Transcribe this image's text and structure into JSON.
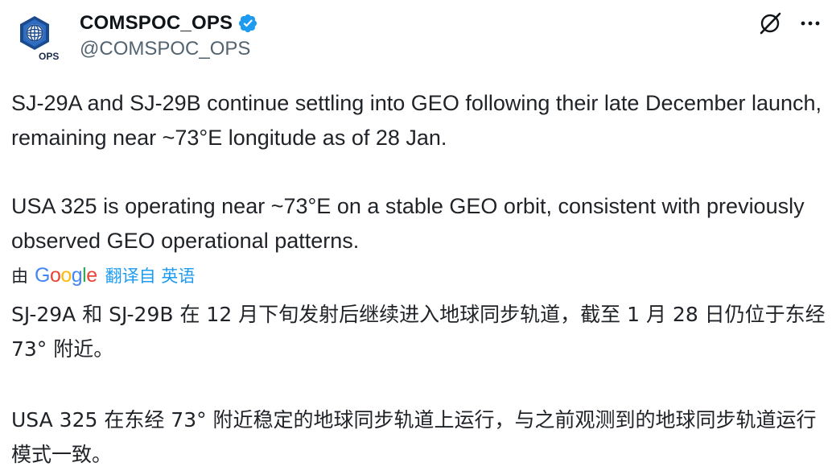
{
  "author": {
    "display_name": "COMSPOC_OPS",
    "handle": "@COMSPOC_OPS",
    "avatar_text": "OPS",
    "verified": true
  },
  "icons": {
    "avatar": "comspoc-hexagon-logo",
    "verified": "verified-badge-icon",
    "grok": "grok-icon",
    "more": "more-horizontal-icon"
  },
  "colors": {
    "accent": "#1d9bf0",
    "text": "#1f2328",
    "secondary": "#536471"
  },
  "tweet": {
    "paragraphs": [
      "SJ-29A and SJ-29B continue settling into GEO following their late December launch, remaining near ~73°E longitude as of 28 Jan.",
      "USA 325 is operating near ~73°E on a stable GEO orbit, consistent with previously observed GEO operational patterns."
    ]
  },
  "translation": {
    "by_label": "由",
    "provider": "Google",
    "link_label": "翻译自 英语",
    "paragraphs": [
      "SJ-29A 和 SJ-29B 在 12 月下旬发射后继续进入地球同步轨道，截至 1 月 28 日仍位于东经 73° 附近。",
      "USA 325 在东经 73° 附近稳定的地球同步轨道上运行，与之前观测到的地球同步轨道运行模式一致。"
    ]
  }
}
